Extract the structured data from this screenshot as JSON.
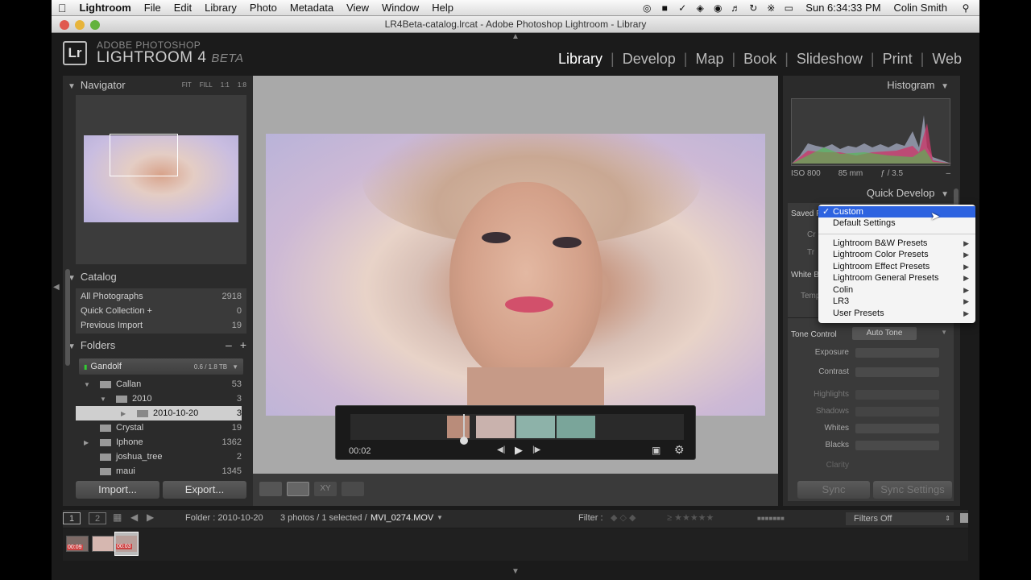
{
  "menubar": {
    "app": "Lightroom",
    "items": [
      "File",
      "Edit",
      "Library",
      "Photo",
      "Metadata",
      "View",
      "Window",
      "Help"
    ],
    "clock": "Sun 6:34:33 PM",
    "user": "Colin Smith"
  },
  "window": {
    "title": "LR4Beta-catalog.lrcat - Adobe Photoshop Lightroom - Library"
  },
  "header": {
    "logo": "Lr",
    "adobe": "ADOBE PHOTOSHOP",
    "product": "LIGHTROOM 4",
    "beta": "BETA",
    "modules": [
      "Library",
      "Develop",
      "Map",
      "Book",
      "Slideshow",
      "Print",
      "Web"
    ],
    "active_module": "Library"
  },
  "navigator": {
    "title": "Navigator",
    "zoom_options": [
      "FIT",
      "FILL",
      "1:1",
      "1:8"
    ]
  },
  "catalog": {
    "title": "Catalog",
    "items": [
      {
        "label": "All Photographs",
        "count": "2918"
      },
      {
        "label": "Quick Collection +",
        "count": "0"
      },
      {
        "label": "Previous Import",
        "count": "19"
      }
    ]
  },
  "folders": {
    "title": "Folders",
    "volume": {
      "label": "Gandolf",
      "size": "0.6 / 1.8 TB"
    },
    "items": [
      {
        "label": "Callan",
        "count": "53"
      },
      {
        "label": "2010",
        "count": "3"
      },
      {
        "label": "2010-10-20",
        "count": "3"
      },
      {
        "label": "Crystal",
        "count": "19"
      },
      {
        "label": "Iphone",
        "count": "1362"
      },
      {
        "label": "joshua_tree",
        "count": "2"
      },
      {
        "label": "maui",
        "count": "1345"
      }
    ]
  },
  "left_buttons": {
    "import": "Import...",
    "export": "Export..."
  },
  "video": {
    "time": "00:02"
  },
  "histogram": {
    "title": "Histogram",
    "iso": "ISO 800",
    "focal": "85 mm",
    "aperture": "ƒ / 3.5",
    "dash": "–"
  },
  "quick_develop": {
    "title": "Quick Develop",
    "saved_label": "Saved P",
    "white_label": "White B",
    "temp_label": "Temp",
    "crop_label": "Cr",
    "treatment_label": "Tr",
    "tone_control": "Tone Control",
    "auto_tone": "Auto Tone",
    "tone_rows": [
      "Exposure",
      "Contrast",
      "Highlights",
      "Shadows",
      "Whites",
      "Blacks",
      "Clarity"
    ]
  },
  "preset_menu": {
    "selected": "Custom",
    "items": [
      {
        "label": "Custom",
        "submenu": false
      },
      {
        "label": "Default Settings",
        "submenu": false
      },
      {
        "label": "Lightroom B&W Presets",
        "submenu": true
      },
      {
        "label": "Lightroom Color Presets",
        "submenu": true
      },
      {
        "label": "Lightroom Effect Presets",
        "submenu": true
      },
      {
        "label": "Lightroom General Presets",
        "submenu": true
      },
      {
        "label": "Colin",
        "submenu": true
      },
      {
        "label": "LR3",
        "submenu": true
      },
      {
        "label": "User Presets",
        "submenu": true
      }
    ]
  },
  "sync": {
    "sync": "Sync",
    "sync_settings": "Sync Settings"
  },
  "filmstrip_bar": {
    "page1": "1",
    "page2": "2",
    "folder": "Folder : 2010-10-20",
    "selection": "3 photos / 1 selected /",
    "filename": "MVI_0274.MOV",
    "filter_label": "Filter :",
    "filter_value": "Filters Off"
  },
  "thumbnails": [
    "00:09",
    "",
    "00:03"
  ],
  "colors": {
    "accent": "#2d63e0",
    "panel": "#2e2e2e",
    "background": "#1b1b1b"
  }
}
